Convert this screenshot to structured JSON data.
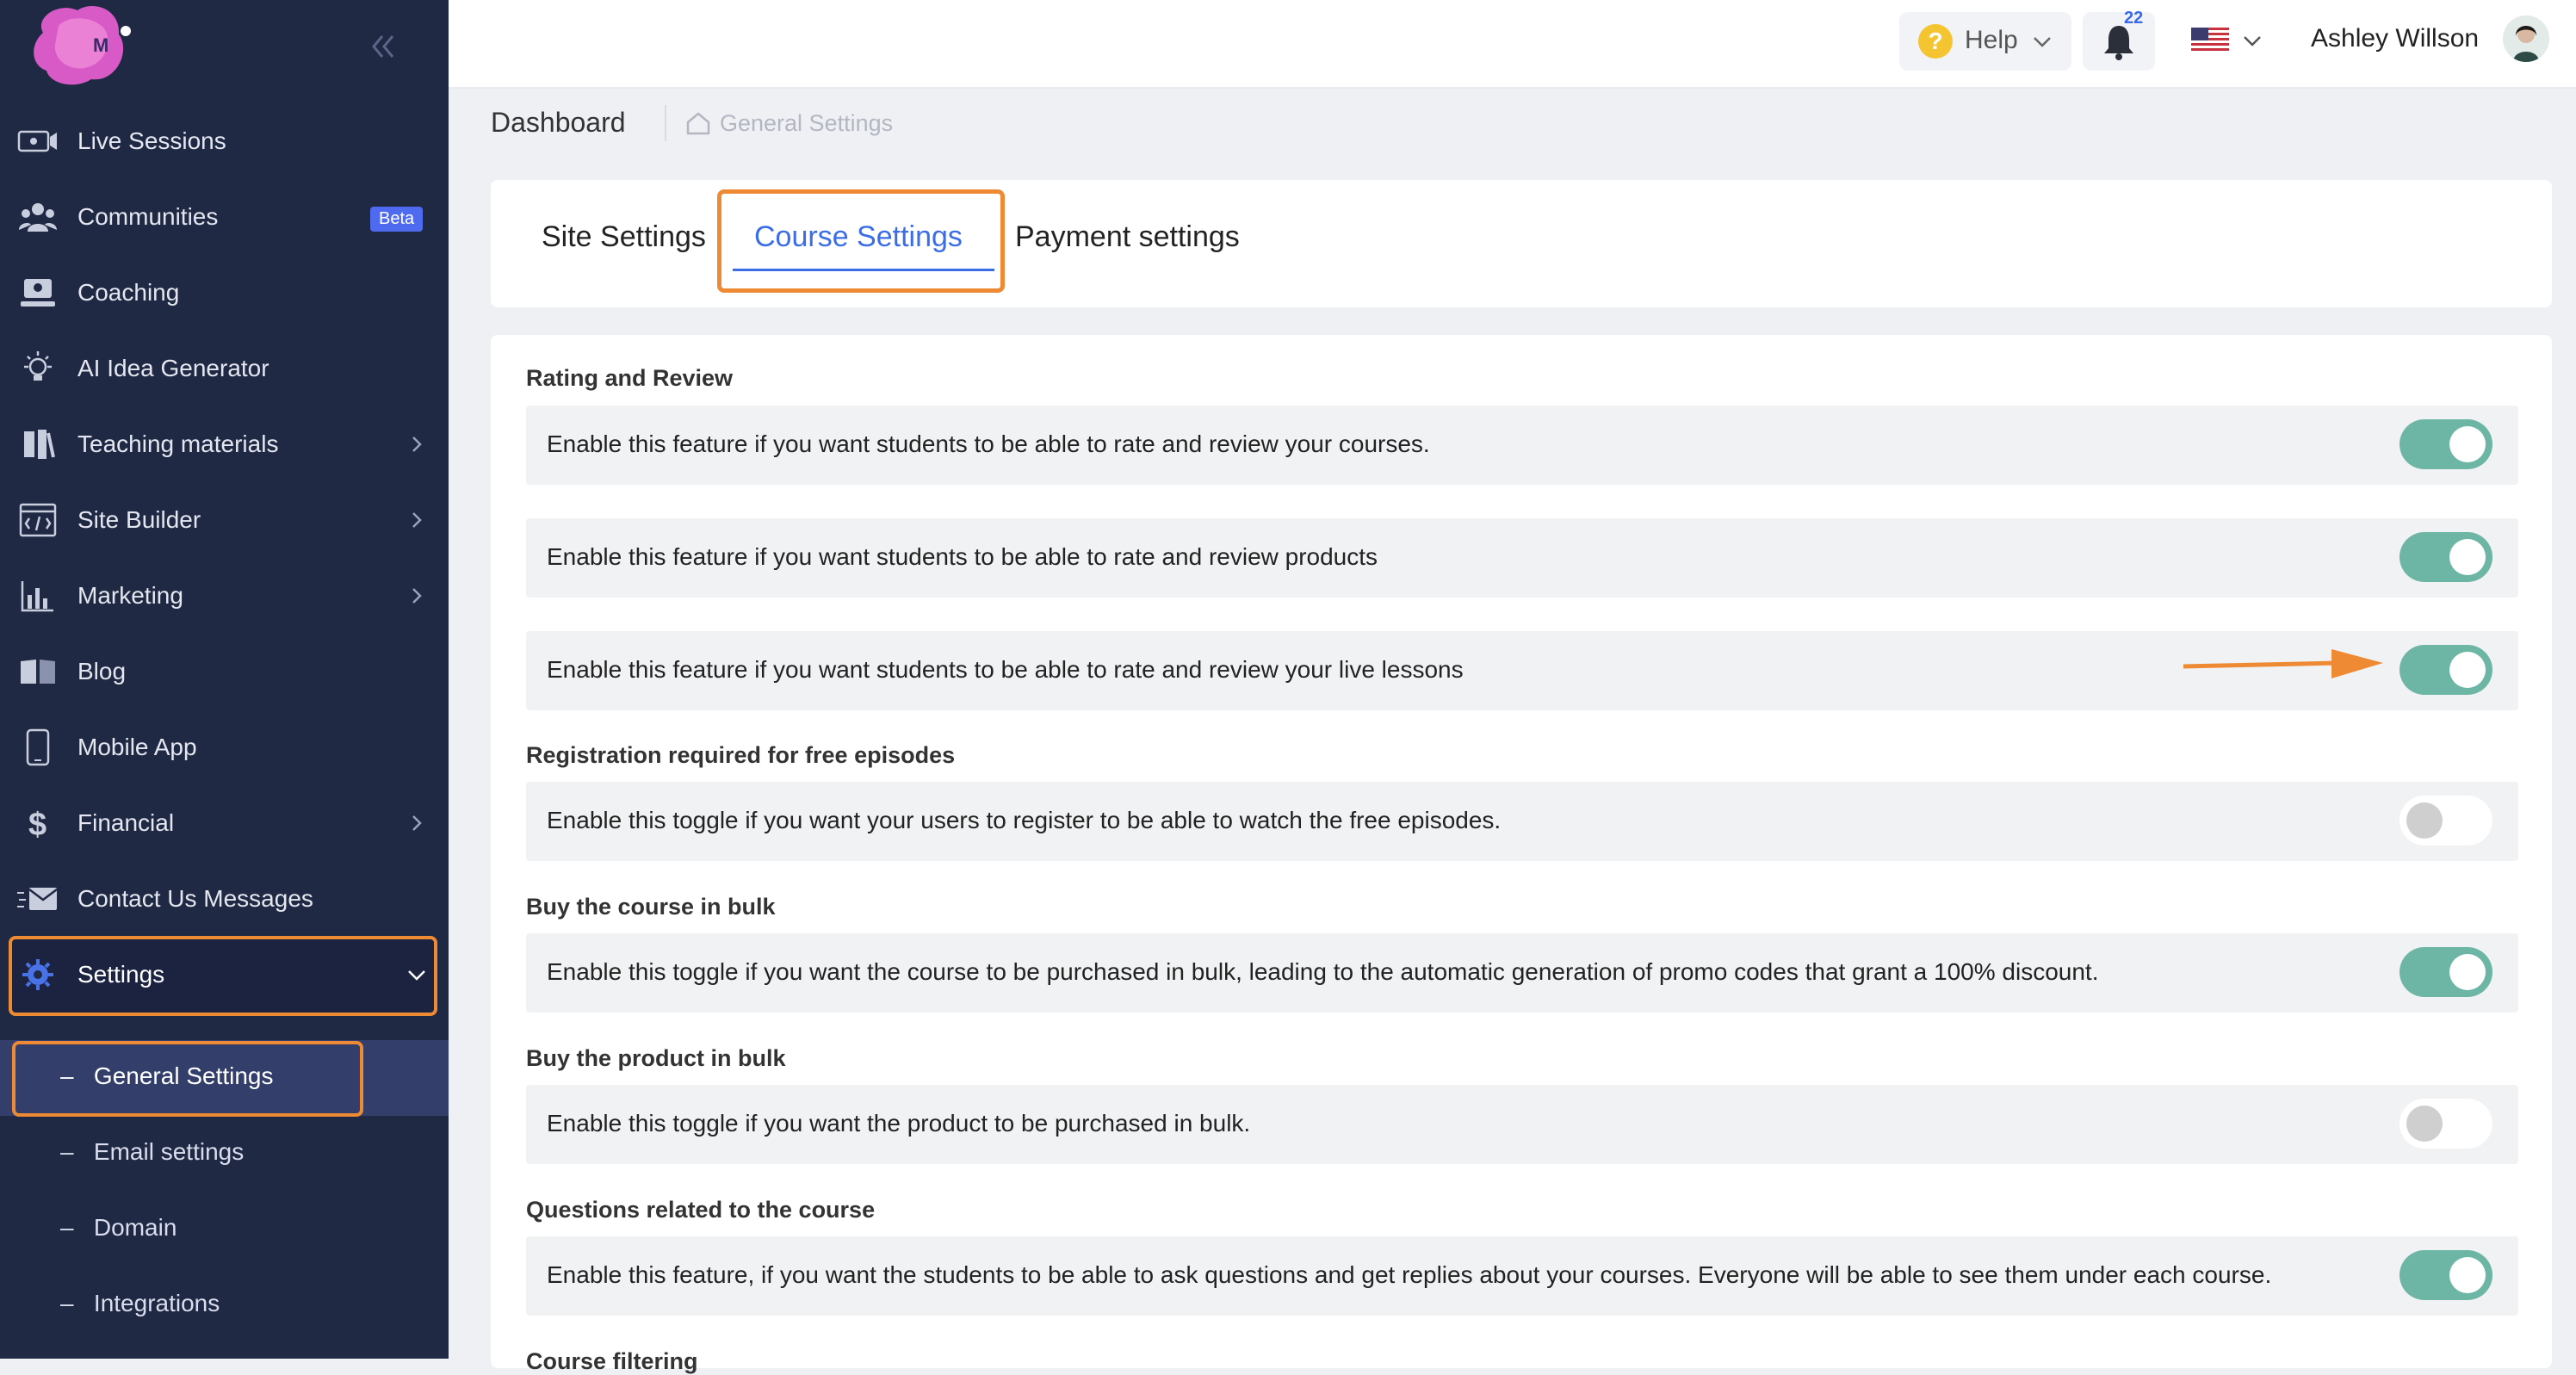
{
  "sidebar": {
    "items": [
      {
        "label": "Live Sessions"
      },
      {
        "label": "Communities",
        "badge": "Beta"
      },
      {
        "label": "Coaching"
      },
      {
        "label": "AI Idea Generator"
      },
      {
        "label": "Teaching materials"
      },
      {
        "label": "Site Builder"
      },
      {
        "label": "Marketing"
      },
      {
        "label": "Blog"
      },
      {
        "label": "Mobile App"
      },
      {
        "label": "Financial"
      },
      {
        "label": "Contact Us Messages"
      },
      {
        "label": "Settings"
      }
    ],
    "subitems": [
      {
        "label": "General Settings"
      },
      {
        "label": "Email settings"
      },
      {
        "label": "Domain"
      },
      {
        "label": "Integrations"
      }
    ]
  },
  "topbar": {
    "help_label": "Help",
    "notification_count": "22",
    "user_name": "Ashley Willson"
  },
  "breadcrumb": {
    "title": "Dashboard",
    "current": "General Settings"
  },
  "tabs": [
    {
      "label": "Site Settings"
    },
    {
      "label": "Course Settings",
      "active": true
    },
    {
      "label": "Payment settings"
    }
  ],
  "sections": [
    {
      "title": "Rating and Review"
    },
    {
      "title": "Registration required for free episodes"
    },
    {
      "title": "Buy the course in bulk"
    },
    {
      "title": "Buy the product in bulk"
    },
    {
      "title": "Questions related to the course"
    },
    {
      "title": "Course filtering"
    }
  ],
  "rows": [
    {
      "text": "Enable this feature if you want students to be able to rate and review your courses.",
      "enabled": true
    },
    {
      "text": "Enable this feature if you want students to be able to rate and review products",
      "enabled": true
    },
    {
      "text": "Enable this feature if you want students to be able to rate and review your live lessons",
      "enabled": true
    },
    {
      "text": "Enable this toggle if you want your users to register to be able to watch the free episodes.",
      "enabled": false
    },
    {
      "text": "Enable this toggle if you want the course to be purchased in bulk, leading to the automatic generation of promo codes that grant a 100% discount.",
      "enabled": true
    },
    {
      "text": "Enable this toggle if you want the product to be purchased in bulk.",
      "enabled": false
    },
    {
      "text": "Enable this feature, if you want the students to be able to ask questions and get replies about your courses. Everyone will be able to see them under each course.",
      "enabled": true
    }
  ],
  "colors": {
    "sidebar_bg": "#202944",
    "accent_orange": "#ee8a34",
    "toggle_on": "#6db5a4",
    "link_blue": "#3b6de6"
  }
}
